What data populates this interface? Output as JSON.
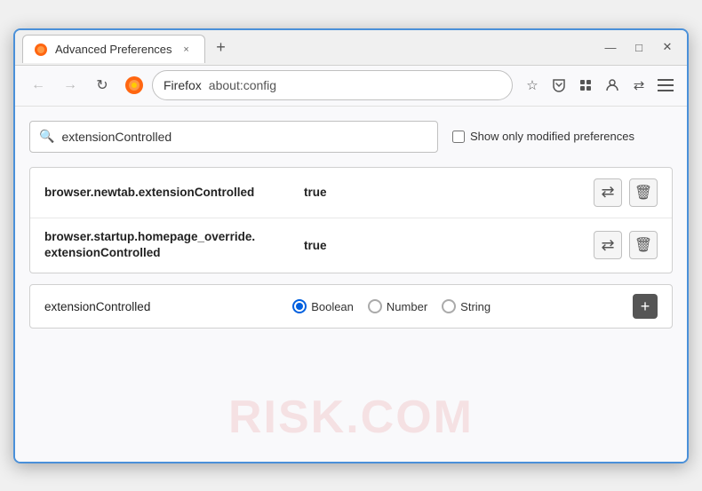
{
  "window": {
    "title": "Advanced Preferences",
    "tab_label": "Advanced Preferences",
    "tab_close": "×",
    "new_tab": "+",
    "win_minimize": "—",
    "win_maximize": "□",
    "win_close": "✕"
  },
  "nav": {
    "back": "←",
    "forward": "→",
    "reload": "↻",
    "firefox_label": "Firefox",
    "address": "about:config",
    "bookmark_icon": "☆",
    "pocket_icon": "⛉",
    "extensions_icon": "⊞",
    "profile_icon": "⊙",
    "sync_icon": "⇄"
  },
  "content": {
    "search_value": "extensionControlled",
    "search_placeholder": "extensionControlled",
    "show_modified_label": "Show only modified preferences",
    "results": [
      {
        "pref_name": "browser.newtab.extensionControlled",
        "value": "true",
        "multi_line": false
      },
      {
        "pref_name_line1": "browser.startup.homepage_override.",
        "pref_name_line2": "extensionControlled",
        "value": "true",
        "multi_line": true
      }
    ],
    "add_pref": {
      "name": "extensionControlled",
      "type_boolean": "Boolean",
      "type_number": "Number",
      "type_string": "String",
      "selected_type": "Boolean",
      "add_button": "+"
    },
    "watermark": "RISK.COM"
  }
}
